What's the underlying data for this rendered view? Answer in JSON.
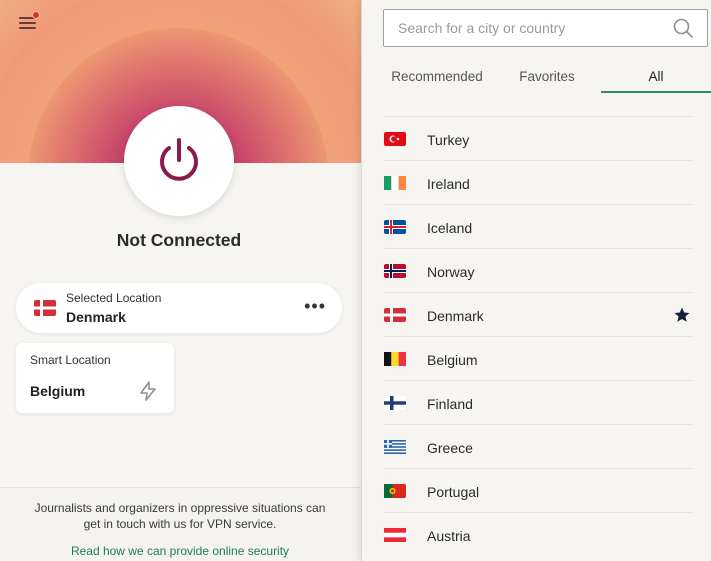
{
  "app": {
    "status": "Not Connected",
    "has_notification": true
  },
  "selected_location": {
    "label": "Selected Location",
    "value": "Denmark",
    "flag": "flag-denmark",
    "more_icon": "more-horizontal-icon"
  },
  "smart_location": {
    "label": "Smart Location",
    "value": "Belgium",
    "icon": "lightning-icon"
  },
  "promo": {
    "text": "Journalists and organizers in oppressive situations can get in touch with us for VPN service.",
    "link": "Read how we can provide online security"
  },
  "search": {
    "placeholder": "Search for a city or country",
    "value": ""
  },
  "tabs": [
    {
      "label": "Recommended",
      "active": false
    },
    {
      "label": "Favorites",
      "active": false
    },
    {
      "label": "All",
      "active": true
    }
  ],
  "countries": [
    {
      "name": "Turkey",
      "flag": "flag-turkey",
      "favorite": false
    },
    {
      "name": "Ireland",
      "flag": "flag-ireland",
      "favorite": false
    },
    {
      "name": "Iceland",
      "flag": "flag-iceland",
      "favorite": false
    },
    {
      "name": "Norway",
      "flag": "flag-norway",
      "favorite": false
    },
    {
      "name": "Denmark",
      "flag": "flag-denmark",
      "favorite": true
    },
    {
      "name": "Belgium",
      "flag": "flag-belgium",
      "favorite": false
    },
    {
      "name": "Finland",
      "flag": "flag-finland",
      "favorite": false
    },
    {
      "name": "Greece",
      "flag": "flag-greece",
      "favorite": false
    },
    {
      "name": "Portugal",
      "flag": "flag-portugal",
      "favorite": false
    },
    {
      "name": "Austria",
      "flag": "flag-austria",
      "favorite": false
    }
  ],
  "colors": {
    "accent": "#2e8b6b",
    "power_icon": "#8c1a4e",
    "notification": "#e02b2b"
  }
}
